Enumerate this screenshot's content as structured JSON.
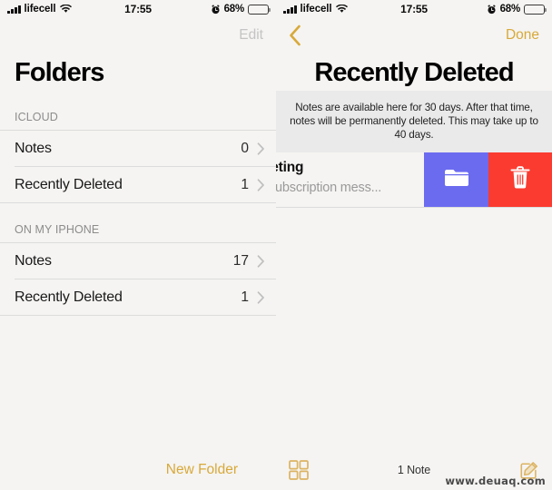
{
  "status_bar": {
    "carrier": "lifecell",
    "time": "17:55",
    "battery_percent": "68%",
    "signal_icon": "signal-bars-icon",
    "wifi_icon": "wifi-icon",
    "alarm_icon": "alarm-clock-icon",
    "battery_icon": "battery-icon"
  },
  "colors": {
    "accent": "#d8a93a",
    "move_action": "#6b6bf0",
    "delete_action": "#fb3b30",
    "background": "#f5f4f2",
    "banner_background": "#eaeaea",
    "separator": "#dcdcdc",
    "secondary_text": "#8c8c8c"
  },
  "left_panel": {
    "nav": {
      "edit_label": "Edit",
      "edit_disabled": true
    },
    "title": "Folders",
    "sections": [
      {
        "header": "ICLOUD",
        "rows": [
          {
            "label": "Notes",
            "count": "0"
          },
          {
            "label": "Recently Deleted",
            "count": "1"
          }
        ]
      },
      {
        "header": "ON MY IPHONE",
        "rows": [
          {
            "label": "Notes",
            "count": "17"
          },
          {
            "label": "Recently Deleted",
            "count": "1"
          }
        ]
      }
    ],
    "toolbar": {
      "new_folder_label": "New Folder"
    }
  },
  "right_panel": {
    "nav": {
      "back_icon": "chevron-left-icon",
      "done_label": "Done"
    },
    "title": "Recently Deleted",
    "info_banner": "Notes are available here for 30 days. After that time, notes will be permanently deleted. This may take up to 40 days.",
    "note_row": {
      "title": "rketing",
      "subtitle": "subscription mess...",
      "actions": [
        {
          "name": "move-to-folder",
          "icon": "folder-icon"
        },
        {
          "name": "delete",
          "icon": "trash-icon"
        }
      ]
    },
    "toolbar": {
      "grid_icon": "grid-view-icon",
      "note_count": "1 Note",
      "compose_icon": "compose-icon"
    }
  },
  "watermark": "www.deuaq.com"
}
